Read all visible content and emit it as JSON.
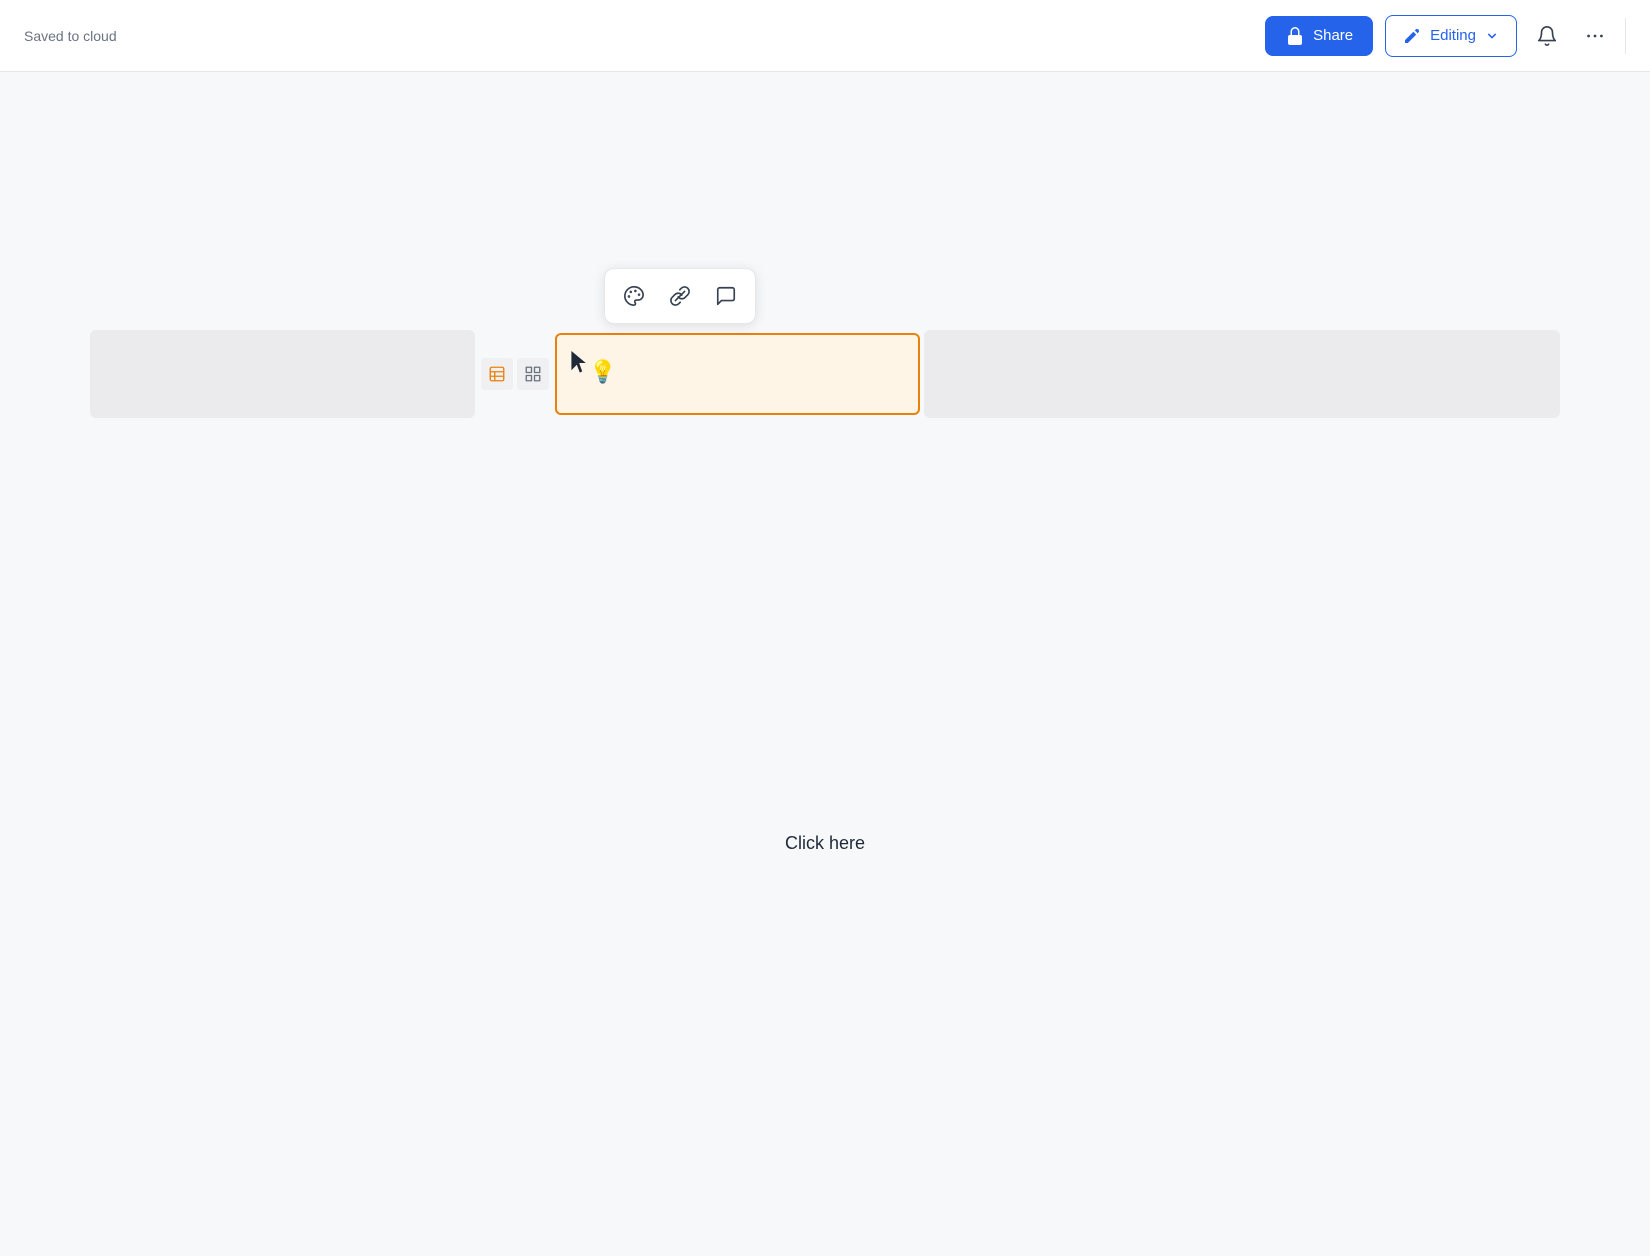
{
  "header": {
    "saved_text": "Saved to cloud",
    "share_label": "Share",
    "editing_label": "Editing",
    "share_icon": "lock-icon",
    "edit_icon": "pencil-icon",
    "bell_icon": "bell-icon",
    "more_icon": "more-icon"
  },
  "toolbar": {
    "palette_icon": "palette-icon",
    "link_icon": "link-icon",
    "comment_icon": "comment-icon"
  },
  "block_controls": {
    "table_icon": "table-icon",
    "grid_icon": "grid-icon"
  },
  "content": {
    "click_here_label": "Click here"
  },
  "colors": {
    "share_bg": "#2563eb",
    "editing_border": "#2563eb",
    "editing_text": "#2563eb",
    "selected_border": "#e8820c",
    "selected_bg": "#fff5e6"
  }
}
